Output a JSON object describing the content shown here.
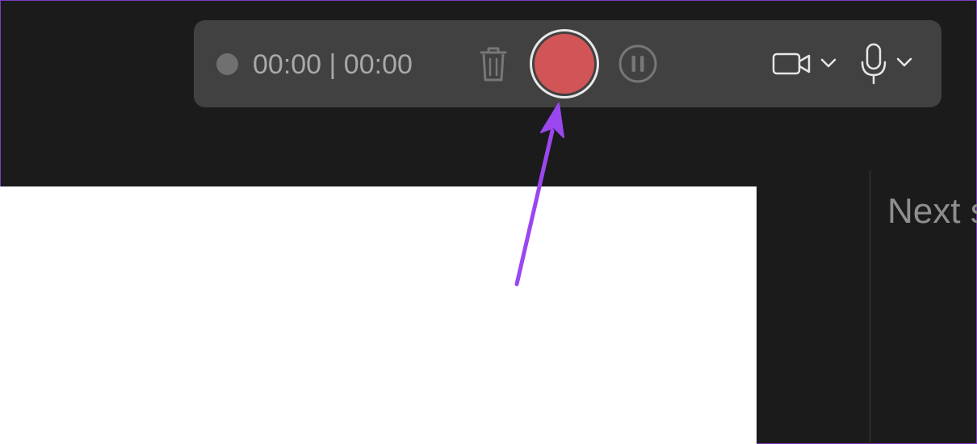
{
  "recorder_toolbar": {
    "timer_text": "00:00 | 00:00",
    "status_dot_icon": "recording-status-dot",
    "trash_icon": "trash-icon",
    "record_icon": "record-icon",
    "pause_icon": "pause-icon",
    "camera_icon": "video-camera-icon",
    "camera_dropdown_icon": "chevron-down-icon",
    "mic_icon": "microphone-icon",
    "mic_dropdown_icon": "chevron-down-icon"
  },
  "presenter": {
    "next_slide_label": "Next s"
  },
  "colors": {
    "background": "#1b1b1b",
    "toolbar": "#414141",
    "record_red": "#d15556",
    "annotation_arrow": "#9b47f0",
    "text_gray": "#a9a9a9"
  }
}
